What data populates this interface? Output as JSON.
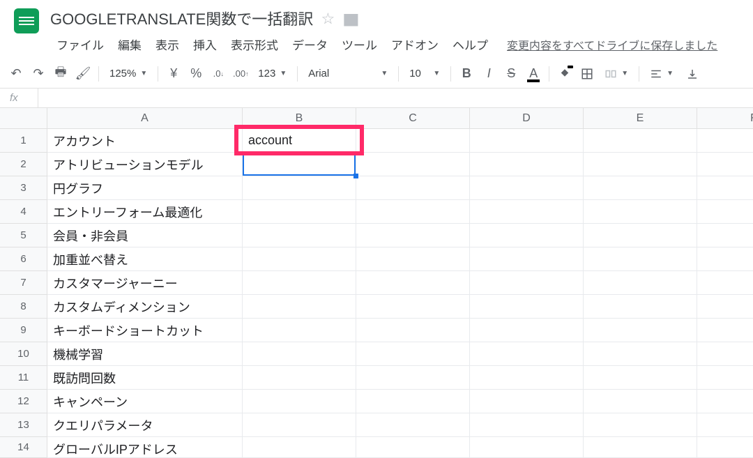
{
  "doc": {
    "title": "GOOGLETRANSLATE関数で一括翻訳",
    "save_status": "変更内容をすべてドライブに保存しました"
  },
  "menu": {
    "file": "ファイル",
    "edit": "編集",
    "view": "表示",
    "insert": "挿入",
    "format": "表示形式",
    "data": "データ",
    "tools": "ツール",
    "addons": "アドオン",
    "help": "ヘルプ"
  },
  "toolbar": {
    "zoom": "125%",
    "currency": "¥",
    "percent": "%",
    "dec_dec": ".0",
    "dec_inc": ".00",
    "numfmt": "123",
    "font": "Arial",
    "fontsize": "10",
    "bold": "B",
    "italic": "I",
    "strike": "S",
    "textcolor": "A"
  },
  "formula": {
    "fx": "fx",
    "value": ""
  },
  "columns": [
    "A",
    "B",
    "C",
    "D",
    "E",
    "F"
  ],
  "row_numbers": [
    "1",
    "2",
    "3",
    "4",
    "5",
    "6",
    "7",
    "8",
    "9",
    "10",
    "11",
    "12",
    "13",
    "14"
  ],
  "cells": {
    "A": [
      "アカウント",
      "アトリビューションモデル",
      "円グラフ",
      "エントリーフォーム最適化",
      "会員・非会員",
      "加重並べ替え",
      "カスタマージャーニー",
      "カスタムディメンション",
      "キーボードショートカット",
      "機械学習",
      "既訪問回数",
      "キャンペーン",
      "クエリパラメータ",
      "グローバルIPアドレス"
    ],
    "B": [
      "account",
      "",
      "",
      "",
      "",
      "",
      "",
      "",
      "",
      "",
      "",
      "",
      "",
      ""
    ]
  },
  "selection": {
    "cell": "B2"
  },
  "highlight": {
    "cell": "B1"
  }
}
